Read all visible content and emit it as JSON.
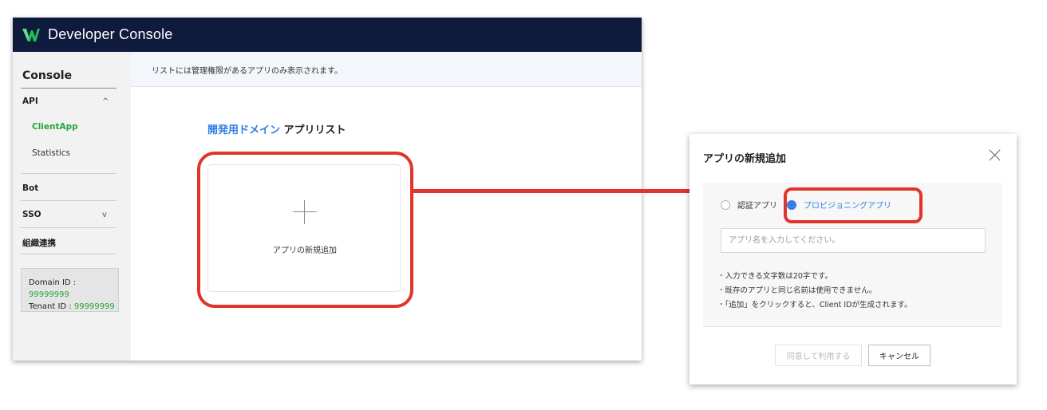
{
  "app": {
    "title": "Developer Console"
  },
  "sidebar": {
    "heading": "Console",
    "items": [
      {
        "label": "API",
        "chevron": "^"
      },
      {
        "label": "ClientApp"
      },
      {
        "label": "Statistics"
      },
      {
        "label": "Bot"
      },
      {
        "label": "SSO",
        "chevron": "v"
      },
      {
        "label": "組織連携"
      }
    ],
    "domain_label": "Domain ID : ",
    "domain_id": "99999999",
    "tenant_label": "Tenant ID : ",
    "tenant_id": "99999999"
  },
  "main": {
    "info": "リストには管理権限があるアプリのみ表示されます。",
    "list_title_highlight": "開発用ドメイン",
    "list_title_rest": "アプリリスト",
    "add_card_label": "アプリの新規追加"
  },
  "dialog": {
    "title": "アプリの新規追加",
    "radio_auth": "認証アプリ",
    "radio_provisioning": "プロビジョニングアプリ",
    "selected_radio": "プロビジョニングアプリ",
    "name_placeholder": "アプリ名を入力してください。",
    "notes": [
      "入力できる文字数は20字です。",
      "既存のアプリと同じ名前は使用できません。",
      "「追加」をクリックすると、Client IDが生成されます。"
    ],
    "agree_button": "同意して利用する",
    "cancel_button": "キャンセル"
  },
  "colors": {
    "topbar": "#0f1b3d",
    "accent_green": "#27a53a",
    "accent_blue": "#2f7de1",
    "highlight_red": "#e0352b"
  }
}
